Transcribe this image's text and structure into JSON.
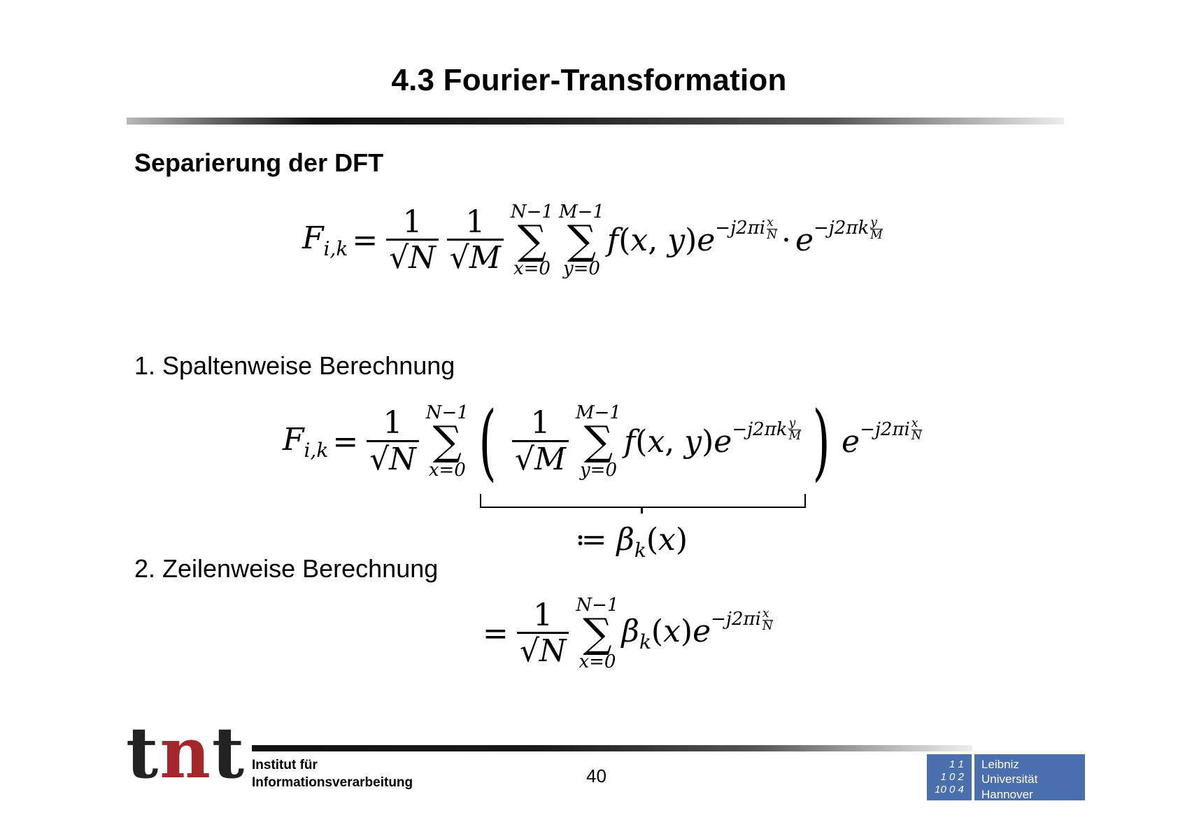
{
  "slide": {
    "title": "4.3 Fourier-Transformation",
    "heading": "Separierung der DFT",
    "step1": "1. Spaltenweise Berechnung",
    "step2": "2. Zeilenweise Berechnung",
    "page_number": "40"
  },
  "formulas": {
    "full": "F_{i,k} = 1/√N · 1/√M · Σ_{x=0}^{N−1} Σ_{y=0}^{M−1} f(x,y) e^{−j2πi x/N} · e^{−j2πk y/M}",
    "column": "F_{i,k} = 1/√N Σ_{x=0}^{N−1} ( 1/√M Σ_{y=0}^{M−1} f(x,y) e^{−j2πk y/M} ) e^{−j2πi x/N}",
    "beta_definition": "≔ β_k(x)",
    "row": "= 1/√N Σ_{x=0}^{N−1} β_k(x) e^{−j2πi x/N}"
  },
  "footer": {
    "logo_text": "tnt",
    "institute_line1": "Institut für",
    "institute_line2": "Informationsverarbeitung",
    "university_line1": "Leibniz",
    "university_line2": "Universität",
    "university_line3": "Hannover",
    "luh_digits": "1 1 / 1 0 2 / 10 0 4"
  }
}
